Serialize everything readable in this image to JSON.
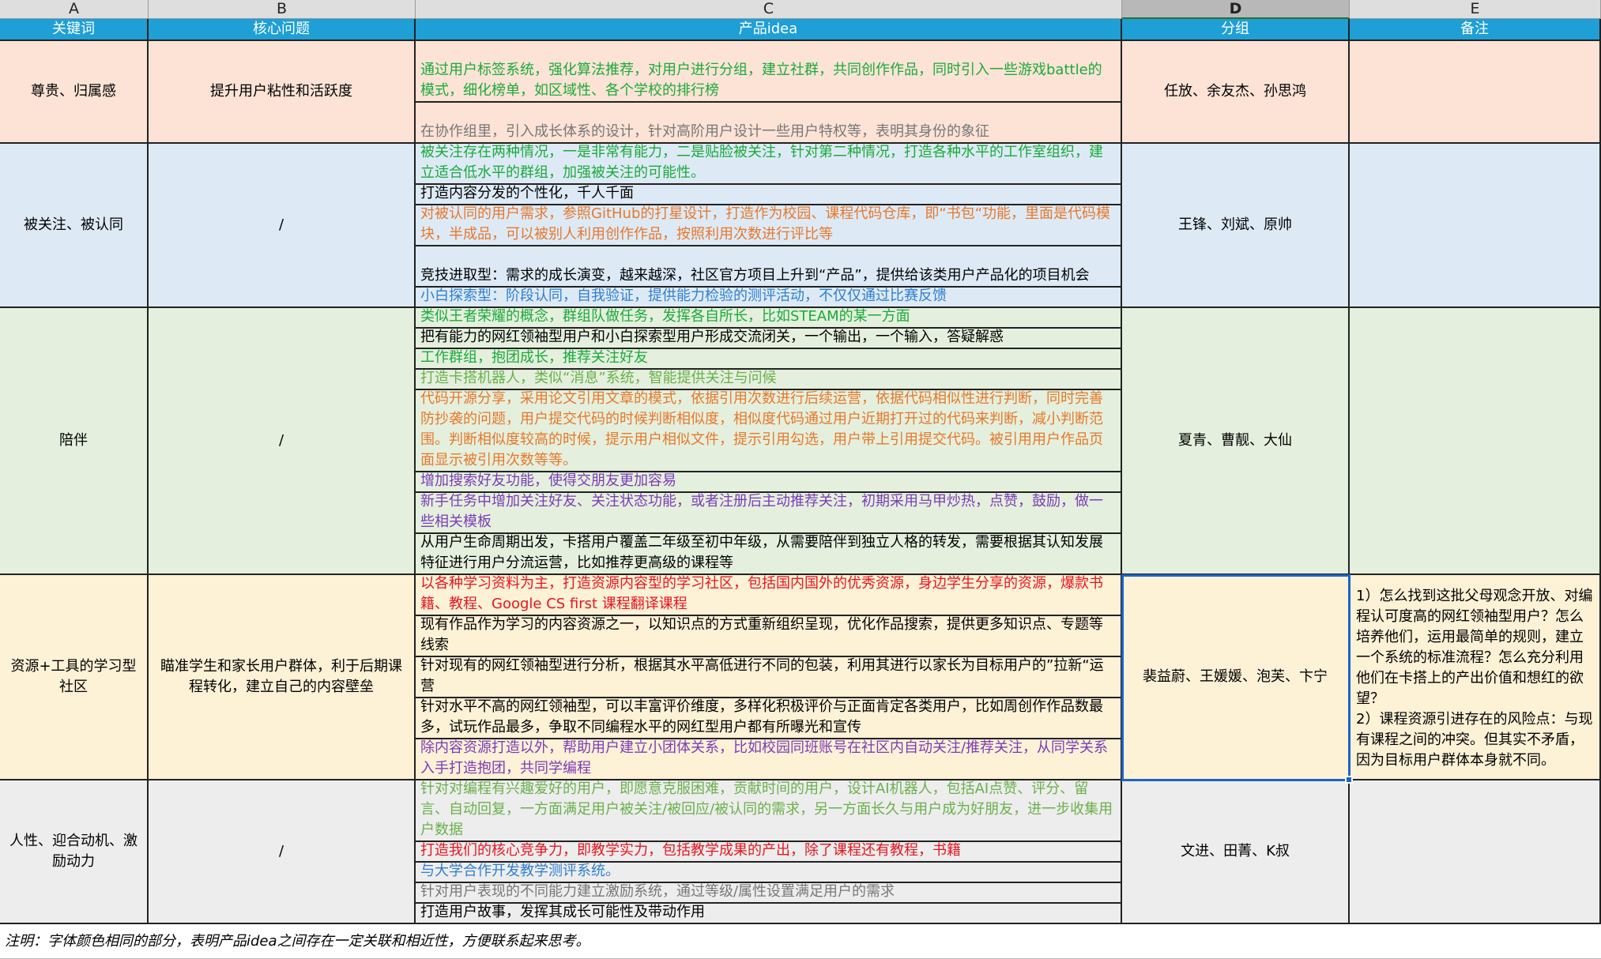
{
  "columns": [
    "A",
    "B",
    "C",
    "D",
    "E"
  ],
  "selected_column": "D",
  "headers": [
    "关键词",
    "核心问题",
    "产品idea",
    "分组",
    "备注"
  ],
  "colors": {
    "green": "#1aaa3a",
    "orange": "#e8772a",
    "blue": "#2e7fd0",
    "lightgreen": "#6ab04c",
    "purple": "#7b3bb8",
    "red": "#e8141e",
    "gray": "#777777",
    "black": "#000000"
  },
  "sections": [
    {
      "keyword": "尊贵、归属感",
      "question": "提升用户粘性和活跃度",
      "group": "任放、余友杰、孙思鸿",
      "note": "",
      "bg": "#fce3d6",
      "ideas": [
        {
          "text": "通过用户标签系统，强化算法推荐，对用户进行分组，建立社群，共同创作作品，同时引入一些游戏battle的模式，细化榜单，如区域性、各个学校的排行榜",
          "color": "green"
        },
        {
          "text": "在协作组里，引入成长体系的设计，针对高阶用户设计一些用户特权等，表明其身份的象征",
          "color": "gray"
        }
      ]
    },
    {
      "keyword": "被关注、被认同",
      "question": "/",
      "group": "王锋、刘斌、原帅",
      "note": "",
      "bg": "#ddeaf6",
      "ideas": [
        {
          "text": "被关注存在两种情况，一是非常有能力，二是贴脸被关注，针对第二种情况，打造各种水平的工作室组织，建立适合低水平的群组，加强被关注的可能性。",
          "color": "green"
        },
        {
          "text": "打造内容分发的个性化，千人千面",
          "color": "black"
        },
        {
          "text": "对被认同的用户需求，参照GitHub的打星设计，打造作为校园、课程代码仓库，即“书包“功能，里面是代码模块，半成品，可以被别人利用创作作品，按照利用次数进行评比等",
          "color": "orange"
        },
        {
          "text": "竞技进取型：需求的成长演变，越来越深，社区官方项目上升到“产品”，提供给该类用户产品化的项目机会",
          "color": "black"
        },
        {
          "text": "小白探索型：阶段认同，自我验证，提供能力检验的测评活动，不仅仅通过比赛反馈",
          "color": "blue"
        }
      ]
    },
    {
      "keyword": "陪伴",
      "question": "/",
      "group": "夏青、曹靓、大仙",
      "note": "",
      "bg": "#e4f0dd",
      "ideas": [
        {
          "text": "类似王者荣耀的概念，群组队做任务，发挥各自所长，比如STEAM的某一方面",
          "color": "green"
        },
        {
          "text": "把有能力的网红领袖型用户和小白探索型用户形成交流闭关，一个输出，一个输入，答疑解惑",
          "color": "black"
        },
        {
          "text": "工作群组，抱团成长，推荐关注好友",
          "color": "green"
        },
        {
          "text": "打造卡搭机器人，类似“消息”系统，智能提供关注与问候",
          "color": "lightgreen"
        },
        {
          "text": "代码开源分享，采用论文引用文章的模式，依据引用次数进行后续运营，依据代码相似性进行判断，同时完善防抄袭的问题，用户提交代码的时候判断相似度，相似度代码通过用户近期打开过的代码来判断，减小判断范围。判断相似度较高的时候，提示用户相似文件，提示引用勾选，用户带上引用提交代码。被引用用户作品页面显示被引用次数等等。",
          "color": "orange"
        },
        {
          "text": "增加搜索好友功能，使得交朋友更加容易",
          "color": "purple"
        },
        {
          "text": "新手任务中增加关注好友、关注状态功能，或者注册后主动推荐关注，初期采用马甲炒热，点赞，鼓励，做一些相关模板",
          "color": "purple"
        },
        {
          "text": "从用户生命周期出发，卡搭用户覆盖二年级至初中年级，从需要陪伴到独立人格的转发，需要根据其认知发展特征进行用户分流运营，比如推荐更高级的课程等",
          "color": "black"
        }
      ]
    },
    {
      "keyword": "资源+工具的学习型社区",
      "question": "瞄准学生和家长用户群体，利于后期课程转化，建立自己的内容壁垒",
      "group": "裴益蔚、王媛媛、泡芙、卞宁",
      "note": "1）怎么找到这批父母观念开放、对编程认可度高的网红领袖型用户？怎么培养他们，运用最简单的规则，建立一个系统的标准流程？怎么充分利用他们在卡搭上的产出价值和想红的欲望？\n2）课程资源引进存在的风险点：与现有课程之间的冲突。但其实不矛盾，因为目标用户群体本身就不同。",
      "bg": "#fdf1d6",
      "ideas": [
        {
          "text": "以各种学习资料为主，打造资源内容型的学习社区，包括国内国外的优秀资源，身边学生分享的资源，爆款书籍、教程、Google CS first 课程翻译课程",
          "color": "red"
        },
        {
          "text": "现有作品作为学习的内容资源之一，以知识点的方式重新组织呈现，优化作品搜索，提供更多知识点、专题等线索",
          "color": "black"
        },
        {
          "text": "针对现有的网红领袖型进行分析，根据其水平高低进行不同的包装，利用其进行以家长为目标用户的”拉新“运营",
          "color": "black"
        },
        {
          "text": "针对水平不高的网红领袖型，可以丰富评价维度，多样化积极评价与正面肯定各类用户，比如周创作作品数最多，试玩作品最多，争取不同编程水平的网红型用户都有所曝光和宣传",
          "color": "black"
        },
        {
          "text": "除内容资源打造以外，帮助用户建立小团体关系，比如校园同班账号在社区内自动关注/推荐关注，从同学关系入手打造抱团，共同学编程",
          "color": "purple"
        }
      ]
    },
    {
      "keyword": "人性、迎合动机、激励动力",
      "question": "/",
      "group": "文进、田菁、K叔",
      "note": "",
      "bg": "#ededed",
      "ideas": [
        {
          "text": "针对对编程有兴趣爱好的用户，即愿意克服困难，贡献时间的用户，设计AI机器人，包括AI点赞、评分、留言、自动回复，一方面满足用户被关注/被回应/被认同的需求，另一方面长久与用户成为好朋友，进一步收集用户数据",
          "color": "lightgreen"
        },
        {
          "text": "打造我们的核心竞争力，即教学实力，包括教学成果的产出，除了课程还有教程，书籍",
          "color": "red"
        },
        {
          "text": "与大学合作开发教学测评系统。",
          "color": "blue"
        },
        {
          "text": "针对用户表现的不同能力建立激励系统，通过等级/属性设置满足用户的需求",
          "color": "gray"
        },
        {
          "text": "打造用户故事，发挥其成长可能性及带动作用",
          "color": "black"
        }
      ]
    }
  ],
  "footnote": "注明：字体颜色相同的部分，表明产品idea之间存在一定关联和相近性，方便联系起来思考。"
}
